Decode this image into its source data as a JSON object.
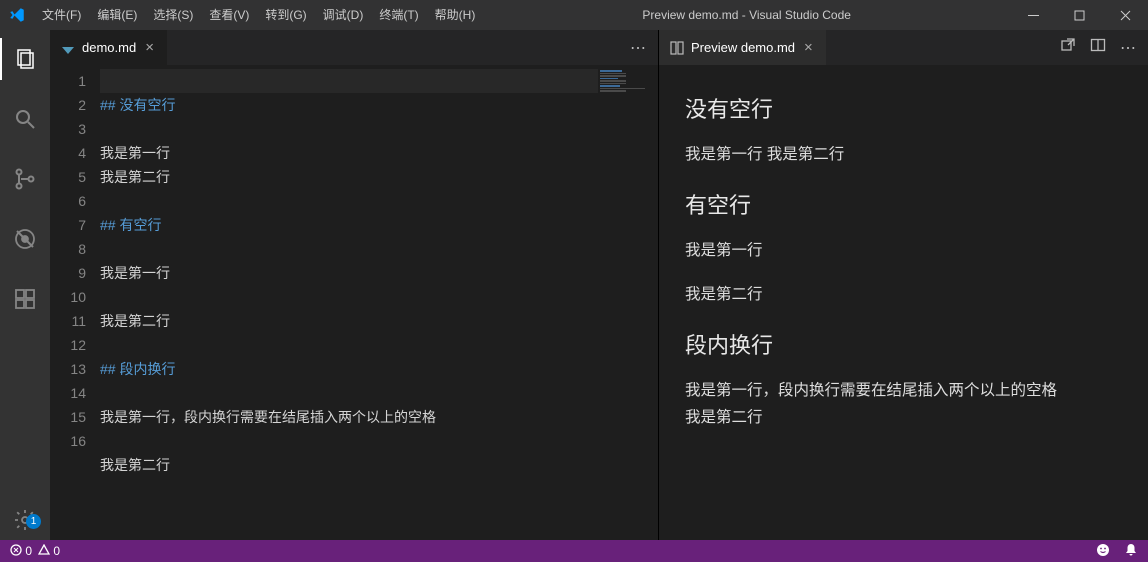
{
  "title": "Preview demo.md - Visual Studio Code",
  "menus": [
    "文件(F)",
    "编辑(E)",
    "选择(S)",
    "查看(V)",
    "转到(G)",
    "调试(D)",
    "终端(T)",
    "帮助(H)"
  ],
  "settings_badge": "1",
  "editor_tab": {
    "filename": "demo.md"
  },
  "preview_tab": {
    "label": "Preview demo.md"
  },
  "code": [
    {
      "n": "1",
      "cls": "cur",
      "text": ""
    },
    {
      "n": "2",
      "cls": "",
      "html": "<span class='hd'>## 没有空行</span>"
    },
    {
      "n": "3",
      "cls": "",
      "text": ""
    },
    {
      "n": "4",
      "cls": "",
      "html": "<span class='txt'>我是第一行</span>"
    },
    {
      "n": "5",
      "cls": "",
      "html": "<span class='txt'>我是第二行</span>"
    },
    {
      "n": "6",
      "cls": "",
      "text": ""
    },
    {
      "n": "7",
      "cls": "",
      "html": "<span class='hd'>## 有空行</span>"
    },
    {
      "n": "8",
      "cls": "",
      "text": ""
    },
    {
      "n": "9",
      "cls": "",
      "html": "<span class='txt'>我是第一行</span>"
    },
    {
      "n": "10",
      "cls": "",
      "text": ""
    },
    {
      "n": "11",
      "cls": "",
      "html": "<span class='txt'>我是第二行</span>"
    },
    {
      "n": "12",
      "cls": "",
      "text": ""
    },
    {
      "n": "13",
      "cls": "",
      "html": "<span class='hd'>## 段内换行</span>"
    },
    {
      "n": "14",
      "cls": "",
      "text": ""
    },
    {
      "n": "15",
      "cls": "",
      "html": "<span class='txt'>我是第一行，段内换行需要在结尾插入两个以上的空格</span>"
    },
    {
      "n": "",
      "cls": "",
      "text": ""
    },
    {
      "n": "16",
      "cls": "",
      "html": "<span class='txt'>我是第二行</span>"
    }
  ],
  "preview": {
    "h1": "没有空行",
    "p1": "我是第一行 我是第二行",
    "h2": "有空行",
    "p2": "我是第一行",
    "p3": "我是第二行",
    "h3": "段内换行",
    "p4a": "我是第一行，段内换行需要在结尾插入两个以上的空格",
    "p4b": "我是第二行"
  },
  "status": {
    "errors": "0",
    "warnings": "0"
  }
}
